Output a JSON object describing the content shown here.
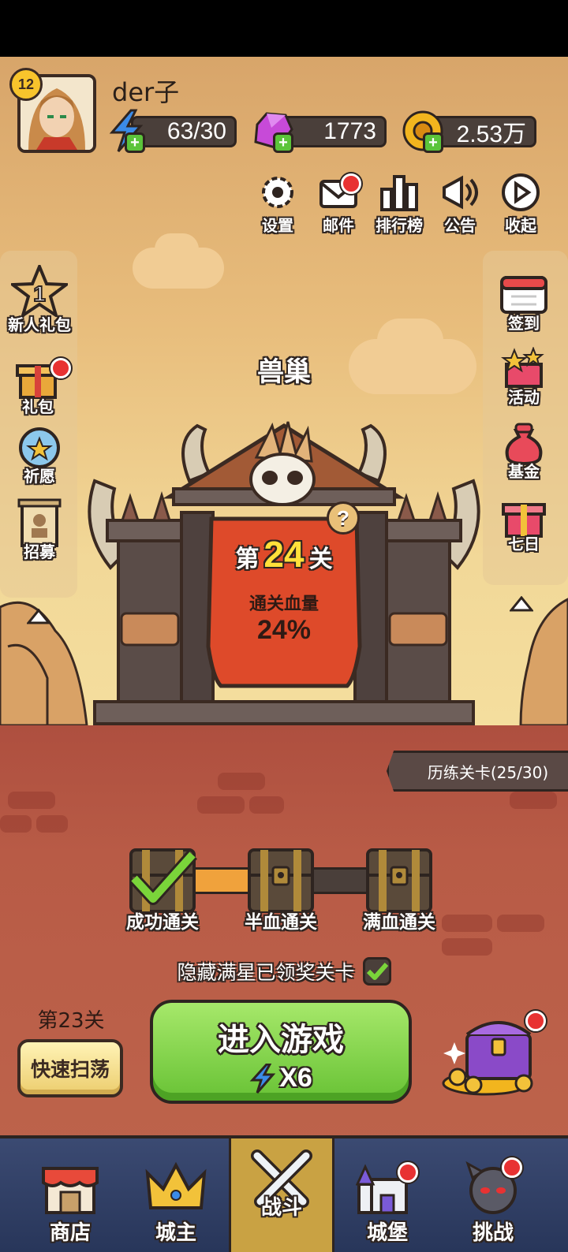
{
  "player": {
    "level": "12",
    "name": "der子"
  },
  "resources": {
    "energy": "63/30",
    "gems": "1773",
    "gold": "2.53万"
  },
  "top_menu": [
    {
      "label": "设置",
      "icon": "gear-icon",
      "badge": false
    },
    {
      "label": "邮件",
      "icon": "mail-icon",
      "badge": true
    },
    {
      "label": "排行榜",
      "icon": "ranking-icon",
      "badge": false
    },
    {
      "label": "公告",
      "icon": "megaphone-icon",
      "badge": false
    },
    {
      "label": "收起",
      "icon": "play-icon",
      "badge": false
    }
  ],
  "left_menu": [
    {
      "label": "新人礼包",
      "icon": "star-1-icon",
      "badge": false
    },
    {
      "label": "礼包",
      "icon": "gift-icon",
      "badge": true
    },
    {
      "label": "祈愿",
      "icon": "wish-orb-icon",
      "badge": false
    },
    {
      "label": "招募",
      "icon": "recruit-scroll-icon",
      "badge": false
    }
  ],
  "right_menu": [
    {
      "label": "签到",
      "icon": "calendar-icon",
      "badge": false
    },
    {
      "label": "活动",
      "icon": "event-box-icon",
      "badge": false
    },
    {
      "label": "基金",
      "icon": "money-bag-icon",
      "badge": false
    },
    {
      "label": "七日",
      "icon": "gift-icon",
      "badge": false
    }
  ],
  "stage": {
    "name": "兽巢",
    "prefix": "第",
    "number": "24",
    "suffix": "关",
    "clear_hp_label": "通关血量",
    "clear_hp_value": "24%",
    "help": "?"
  },
  "trial": {
    "label": "历练关卡(25/30)"
  },
  "rewards": {
    "progress_fraction": 0.4,
    "chests": [
      {
        "label": "成功通关",
        "claimed": true
      },
      {
        "label": "半血通关",
        "claimed": false
      },
      {
        "label": "满血通关",
        "claimed": false
      }
    ]
  },
  "hidden_star": {
    "text": "隐藏满星已领奖关卡",
    "checked": true
  },
  "sweep": {
    "stage_label": "第23关",
    "button_label": "快速扫荡"
  },
  "enter_game": {
    "label": "进入游戏",
    "cost": "X6"
  },
  "bottom_nav": [
    {
      "label": "商店",
      "icon": "shop-icon",
      "badge": false,
      "active": false
    },
    {
      "label": "城主",
      "icon": "crown-icon",
      "badge": false,
      "active": false
    },
    {
      "label": "战斗",
      "icon": "crossed-swords-icon",
      "badge": false,
      "active": true
    },
    {
      "label": "城堡",
      "icon": "castle-icon",
      "badge": true,
      "active": false
    },
    {
      "label": "挑战",
      "icon": "demon-icon",
      "badge": true,
      "active": false
    }
  ],
  "colors": {
    "outline": "#2e2420",
    "accent_green": "#68c235",
    "accent_yellow": "#ffe03a",
    "badge_red": "#e83232"
  }
}
